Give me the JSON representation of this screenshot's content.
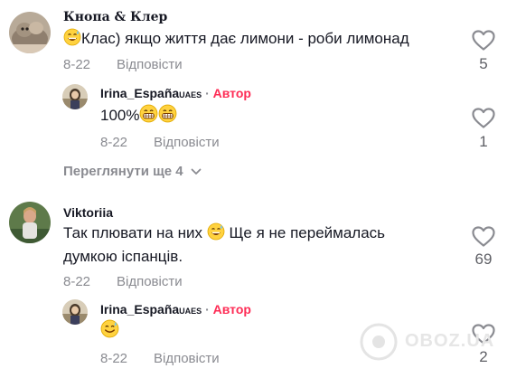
{
  "comments": [
    {
      "username": "Кнопа & Клер",
      "text": "Клас) якщо життя дає лимони - роби лимонад",
      "date": "8-22",
      "reply_label": "Відповісти",
      "likes": "5"
    },
    {
      "username": "Irina_España",
      "username_suffix": "UAES",
      "author_separator": "·",
      "author_badge": "Автор",
      "text": "100%",
      "date": "8-22",
      "reply_label": "Відповісти",
      "likes": "1"
    },
    {
      "more_replies": "Переглянути ще 4"
    },
    {
      "username": "Viktoriia",
      "text_line1": "Так плювати на них",
      "text_line1_rest": "Ще я не переймалась",
      "text_line2": "думкою іспанців.",
      "date": "8-22",
      "reply_label": "Відповісти",
      "likes": "69"
    },
    {
      "username": "Irina_España",
      "username_suffix": "UAES",
      "author_separator": "·",
      "author_badge": "Автор",
      "date": "8-22",
      "reply_label": "Відповісти",
      "likes": "2"
    }
  ],
  "watermark": {
    "text": "OBOZ.UA"
  },
  "colors": {
    "author": "#fe2c55",
    "meta": "#8a8b91",
    "text": "#161823"
  }
}
